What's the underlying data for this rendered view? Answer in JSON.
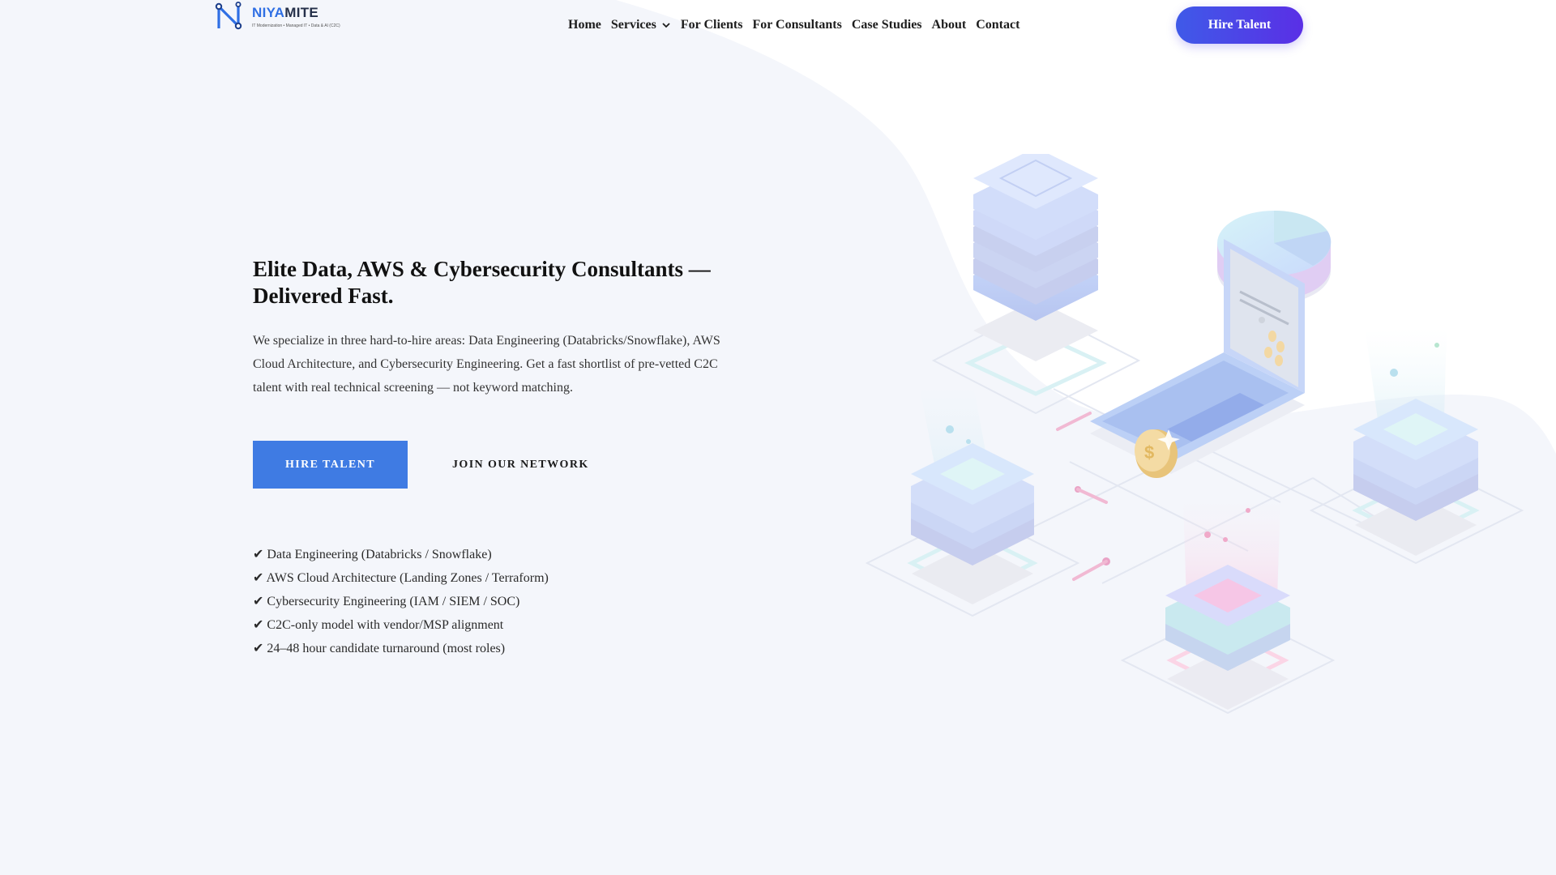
{
  "brand": {
    "name_part1": "NIYA",
    "name_part2": "MITE",
    "tagline": "IT Modernization • Managed IT • Data & AI (C2C)"
  },
  "nav": {
    "items": [
      {
        "label": "Home"
      },
      {
        "label": "Services",
        "has_dropdown": true
      },
      {
        "label": "For Clients"
      },
      {
        "label": "For Consultants"
      },
      {
        "label": "Case Studies"
      },
      {
        "label": "About"
      },
      {
        "label": "Contact"
      }
    ],
    "cta_label": "Hire Talent"
  },
  "hero": {
    "title": "Elite Data, AWS & Cybersecurity Consultants — Delivered Fast.",
    "description": "We specialize in three hard-to-hire areas: Data Engineering (Databricks/Snowflake), AWS Cloud Architecture, and Cybersecurity Engineering. Get a fast shortlist of pre-vetted C2C talent with real technical screening — not keyword matching.",
    "primary_cta": "HIRE TALENT",
    "secondary_cta": "JOIN OUR NETWORK",
    "checklist": [
      "✔ Data Engineering (Databricks / Snowflake)",
      "✔ AWS Cloud Architecture (Landing Zones / Terraform)",
      "✔ Cybersecurity Engineering (IAM / SIEM / SOC)",
      "✔ C2C-only model with vendor/MSP alignment",
      "✔ 24–48 hour candidate turnaround (most roles)"
    ]
  },
  "colors": {
    "accent_blue": "#3f7be3",
    "pill_gradient_start": "#3f5ae8",
    "pill_gradient_end": "#5a2fe6",
    "brand_blue": "#2f6fe4",
    "page_bg": "#f4f6fb"
  },
  "icons": {
    "logo": "n-network-logo-icon",
    "dropdown": "chevron-down-icon",
    "illustration": "isometric-data-servers-laptop-illustration"
  }
}
